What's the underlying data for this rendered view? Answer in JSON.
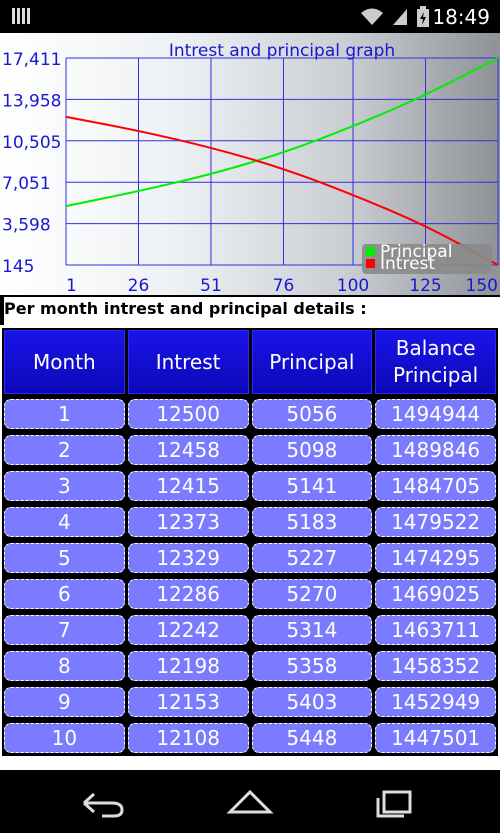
{
  "status_bar": {
    "time": "18:49"
  },
  "chart_data": {
    "type": "line",
    "title": "Intrest and principal graph",
    "x_ticks": [
      "1",
      "26",
      "51",
      "76",
      "100",
      "125",
      "150"
    ],
    "y_ticks": [
      "17,411",
      "13,958",
      "10,505",
      "7,051",
      "3,598",
      "145"
    ],
    "xlim": [
      1,
      150
    ],
    "ylim": [
      145,
      17411
    ],
    "grid": true,
    "legend_position": "bottom-right",
    "series": [
      {
        "name": "Principal",
        "color": "#00ee00",
        "x": [
          1,
          26,
          51,
          76,
          100,
          125,
          150
        ],
        "y": [
          5056,
          6300,
          7700,
          9500,
          11700,
          14300,
          17411
        ]
      },
      {
        "name": "Intrest",
        "color": "#ff0000",
        "x": [
          1,
          26,
          51,
          76,
          100,
          125,
          150
        ],
        "y": [
          12500,
          11350,
          9950,
          8200,
          6000,
          3450,
          145
        ]
      }
    ]
  },
  "section_label": "Per month intrest and principal details :",
  "table": {
    "headers": [
      "Month",
      "Intrest",
      "Principal",
      "Balance Principal"
    ],
    "rows": [
      [
        "1",
        "12500",
        "5056",
        "1494944"
      ],
      [
        "2",
        "12458",
        "5098",
        "1489846"
      ],
      [
        "3",
        "12415",
        "5141",
        "1484705"
      ],
      [
        "4",
        "12373",
        "5183",
        "1479522"
      ],
      [
        "5",
        "12329",
        "5227",
        "1474295"
      ],
      [
        "6",
        "12286",
        "5270",
        "1469025"
      ],
      [
        "7",
        "12242",
        "5314",
        "1463711"
      ],
      [
        "8",
        "12198",
        "5358",
        "1458352"
      ],
      [
        "9",
        "12153",
        "5403",
        "1452949"
      ],
      [
        "10",
        "12108",
        "5448",
        "1447501"
      ]
    ]
  },
  "navbar": {
    "back_icon": "back-icon",
    "home_icon": "home-icon",
    "recents_icon": "recents-icon"
  }
}
